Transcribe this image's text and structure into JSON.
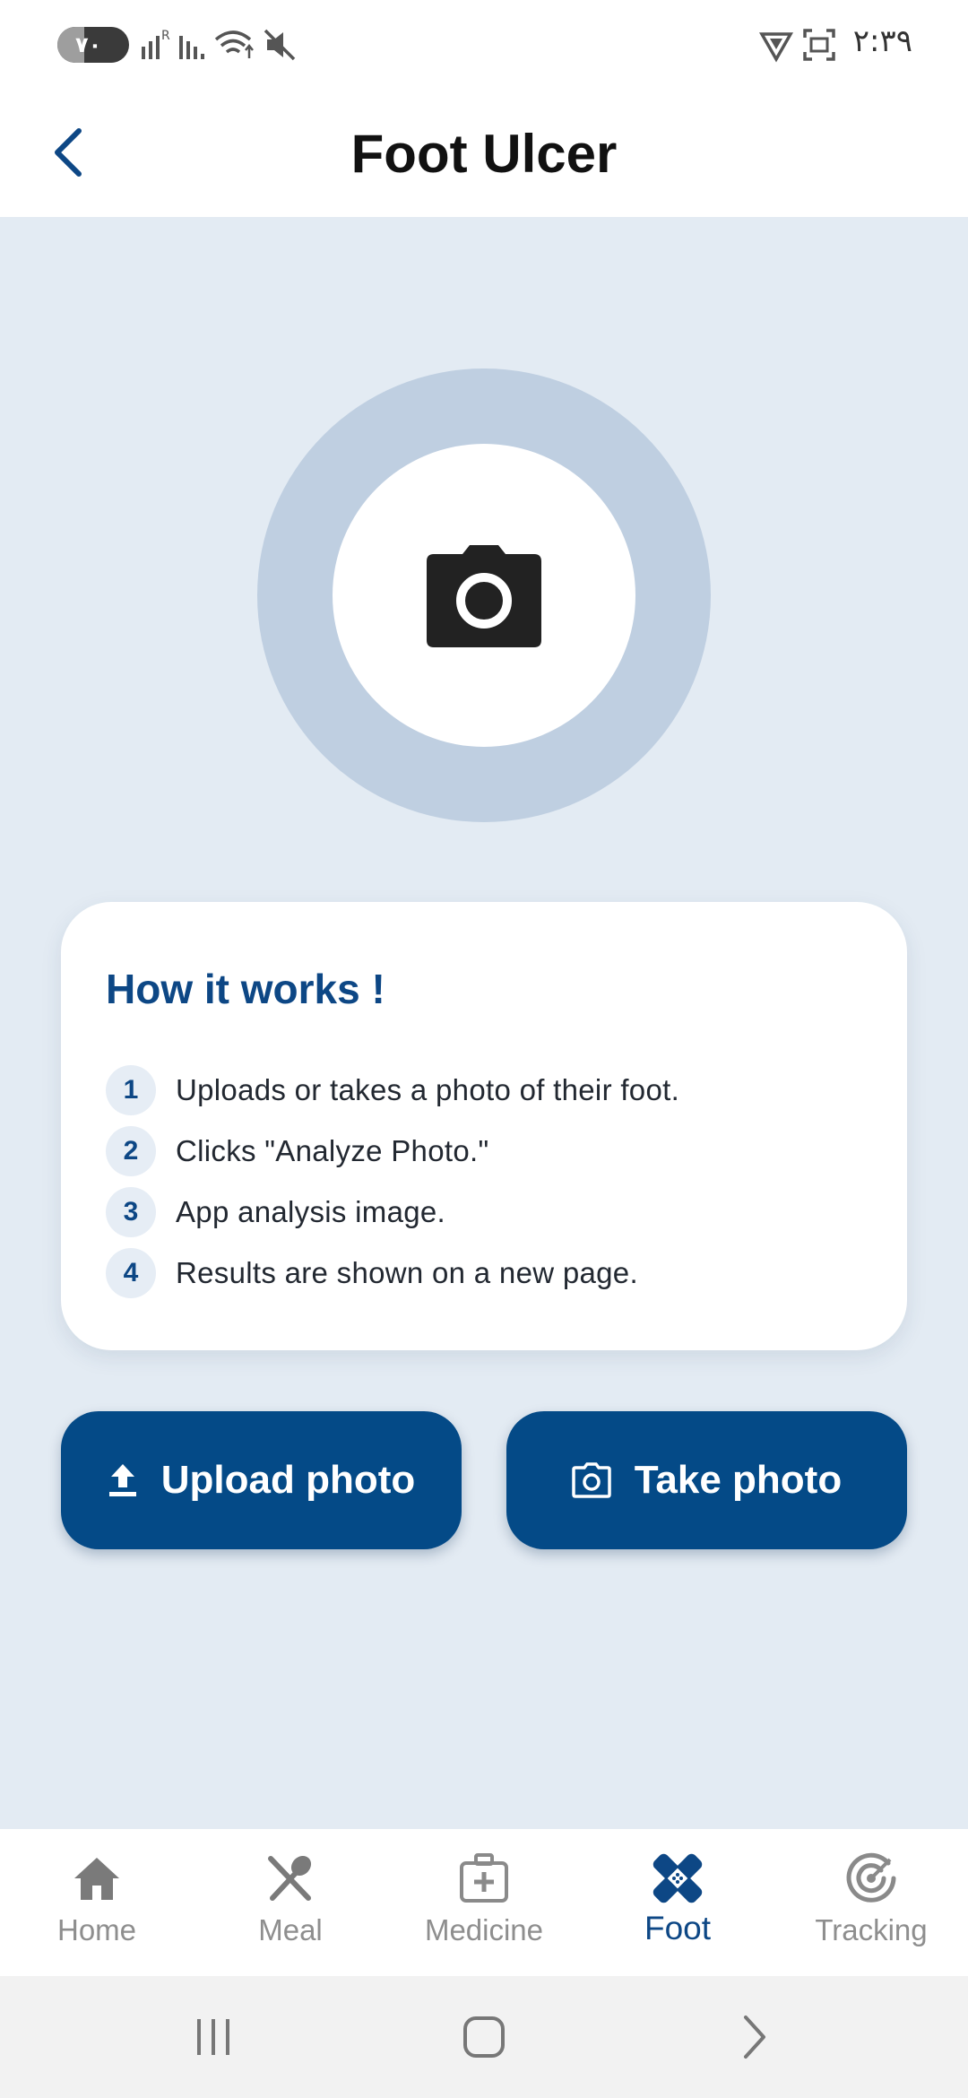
{
  "status_bar": {
    "battery": "۷۰",
    "time": "۲:۳۹"
  },
  "header": {
    "title": "Foot Ulcer"
  },
  "how_it_works": {
    "title": "How it works !",
    "steps": [
      {
        "num": "1",
        "text": "Uploads or takes a photo of their foot."
      },
      {
        "num": "2",
        "text": "Clicks \"Analyze Photo.\""
      },
      {
        "num": "3",
        "text": "App analysis image."
      },
      {
        "num": "4",
        "text": "Results are shown on a new page."
      }
    ]
  },
  "actions": {
    "upload_label": "Upload photo",
    "take_label": "Take photo"
  },
  "nav": {
    "items": [
      {
        "label": "Home",
        "icon": "home-icon"
      },
      {
        "label": "Meal",
        "icon": "utensils-icon"
      },
      {
        "label": "Medicine",
        "icon": "medical-kit-icon"
      },
      {
        "label": "Foot",
        "icon": "bandage-icon",
        "active": true
      },
      {
        "label": "Tracking",
        "icon": "target-icon"
      }
    ]
  },
  "colors": {
    "primary": "#044a87",
    "title_blue": "#0d4785",
    "background": "#e3ebf3",
    "ring": "#bfcfe1",
    "inactive": "#8e8e8e"
  }
}
